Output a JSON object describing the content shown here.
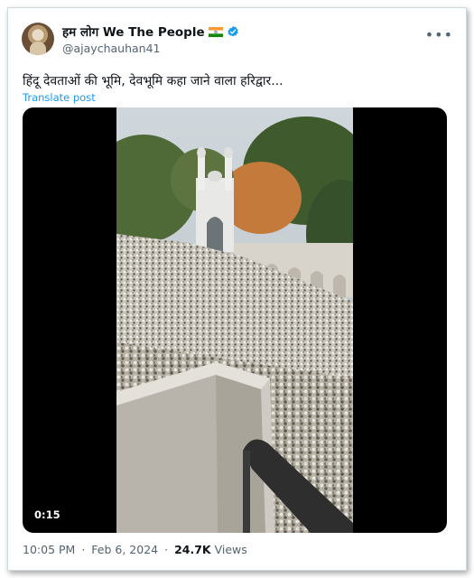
{
  "author": {
    "display_name": "हम लोग We The People",
    "handle": "@ajaychauhan41",
    "flag_icon": "india-flag-icon",
    "verified_color": "#1d9bf0"
  },
  "tweet": {
    "text": "हिंदू देवताओं की भूमि, देवभूमि कहा जाने वाला हरिद्वार...",
    "translate_label": "Translate post"
  },
  "media": {
    "video_duration": "0:15"
  },
  "meta": {
    "time": "10:05 PM",
    "separator": "·",
    "date": "Feb 6, 2024",
    "views_count": "24.7K",
    "views_label": "Views"
  },
  "colors": {
    "link": "#1d9bf0",
    "muted": "#536471",
    "text": "#0f1419"
  }
}
